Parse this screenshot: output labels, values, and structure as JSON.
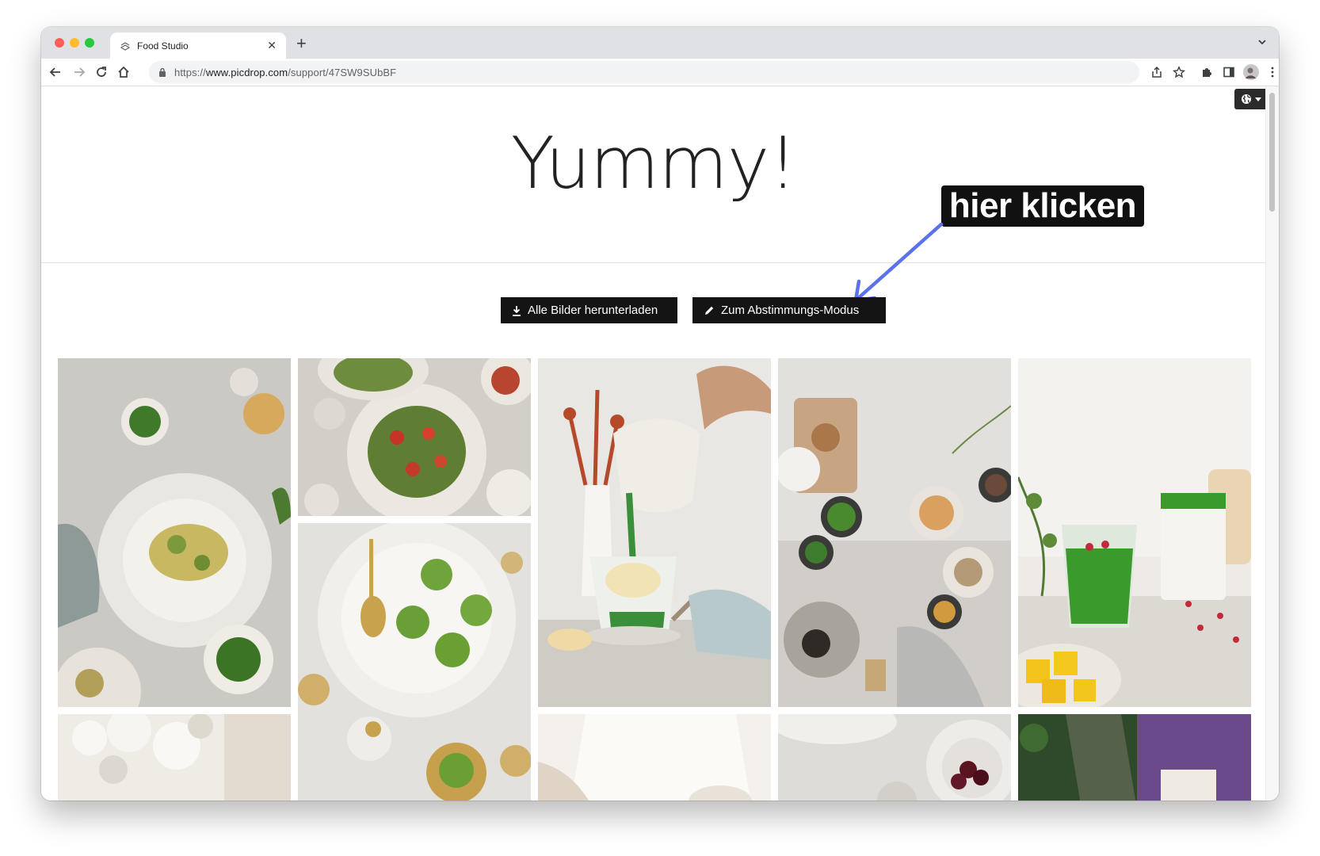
{
  "browser": {
    "tab_title": "Food Studio",
    "url_scheme": "https://",
    "url_host": "www.picdrop.com",
    "url_path": "/support/47SW9SUbBF"
  },
  "page": {
    "title": "Yummy!",
    "download_all_label": "Alle Bilder herunterladen",
    "voting_mode_label": "Zum Abstimmungs-Modus"
  },
  "annotation": {
    "callout_text": "hier klicken"
  },
  "gallery": {
    "photos": [
      {
        "name": "pasta-gnocchi-pesto",
        "palette": [
          "#d3d2cf",
          "#b9b7b1",
          "#8aa06a",
          "#f1efe8"
        ]
      },
      {
        "name": "spinach-tagliatelle-tomatoes",
        "palette": [
          "#d8d5cf",
          "#6d8c44",
          "#c23a2a",
          "#efe8de"
        ]
      },
      {
        "name": "matcha-ice-cream-pour",
        "palette": [
          "#e9e6e2",
          "#f5f3ee",
          "#3b8f3a",
          "#b54a2a"
        ]
      },
      {
        "name": "matcha-ingredients-flatlay",
        "palette": [
          "#e6e4e0",
          "#cfcac2",
          "#3e7d2d",
          "#8b6a4a"
        ]
      },
      {
        "name": "green-smoothie-mango",
        "palette": [
          "#f1efec",
          "#e4dfd8",
          "#3a9a2c",
          "#f2c41c"
        ]
      },
      {
        "name": "matcha-balls-gold-cups",
        "palette": [
          "#e7e5e1",
          "#f6f5f2",
          "#6aa33a",
          "#c9a24e"
        ]
      },
      {
        "name": "white-blossoms",
        "palette": [
          "#f4f2ee",
          "#e8e4dd",
          "#c9c4b8"
        ]
      },
      {
        "name": "person-white-shirt",
        "palette": [
          "#f3efe9",
          "#e6dfd5",
          "#cfc3b4"
        ]
      },
      {
        "name": "cherries-bowl",
        "palette": [
          "#dedcd8",
          "#f2f1ee",
          "#5a1420"
        ]
      },
      {
        "name": "person-purple-apron",
        "palette": [
          "#2f4a2a",
          "#6b4a8c",
          "#e9e2d8"
        ]
      }
    ]
  }
}
